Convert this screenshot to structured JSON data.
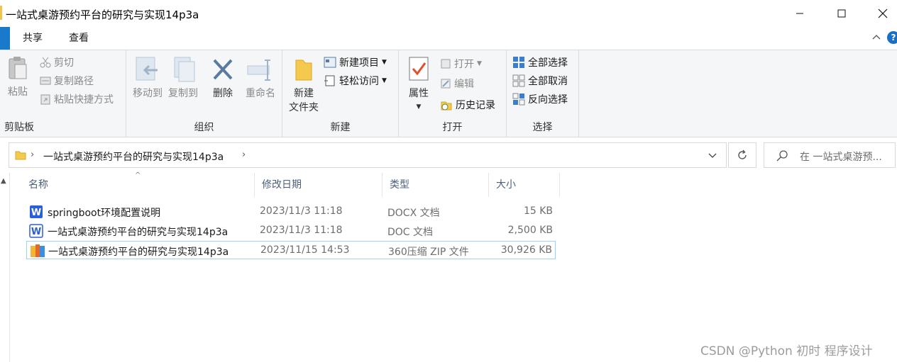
{
  "window": {
    "title": "一站式桌游预约平台的研究与实现14p3a"
  },
  "ribbon_tabs": {
    "share": "共享",
    "view": "查看",
    "help": "?"
  },
  "ribbon": {
    "clipboard": {
      "paste": "粘贴",
      "cut": "剪切",
      "copy_path": "复制路径",
      "paste_shortcut": "粘贴快捷方式",
      "label": "剪贴板"
    },
    "organize": {
      "move_to": "移动到",
      "copy_to": "复制到",
      "delete": "删除",
      "rename": "重命名",
      "label": "组织"
    },
    "new": {
      "new_folder_line1": "新建",
      "new_folder_line2": "文件夹",
      "new_item": "新建项目",
      "easy_access": "轻松访问",
      "label": "新建"
    },
    "open": {
      "properties": "属性",
      "open": "打开",
      "edit": "编辑",
      "history": "历史记录",
      "label": "打开"
    },
    "select": {
      "select_all": "全部选择",
      "select_none": "全部取消",
      "invert": "反向选择",
      "label": "选择"
    }
  },
  "address": {
    "crumb": "一站式桌游预约平台的研究与实现14p3a",
    "search_placeholder": "在 一站式桌游预..."
  },
  "columns": {
    "name": "名称",
    "date": "修改日期",
    "type": "类型",
    "size": "大小"
  },
  "files": [
    {
      "name": "springboot环境配置说明",
      "date": "2023/11/3 11:18",
      "type": "DOCX 文档",
      "size": "15 KB",
      "icon": "wps-docx-icon"
    },
    {
      "name": "一站式桌游预约平台的研究与实现14p3a",
      "date": "2023/11/3 11:18",
      "type": "DOC 文档",
      "size": "2,500 KB",
      "icon": "wps-doc-icon"
    },
    {
      "name": "一站式桌游预约平台的研究与实现14p3a",
      "date": "2023/11/15 14:53",
      "type": "360压缩 ZIP 文件",
      "size": "30,926 KB",
      "icon": "zip-archive-icon"
    }
  ],
  "watermark": "CSDN @Python 初时 程序设计",
  "colors": {
    "accent": "#1979ca",
    "selection_border": "#99d1ff",
    "ribbon_bg": "#f5f6f7"
  }
}
